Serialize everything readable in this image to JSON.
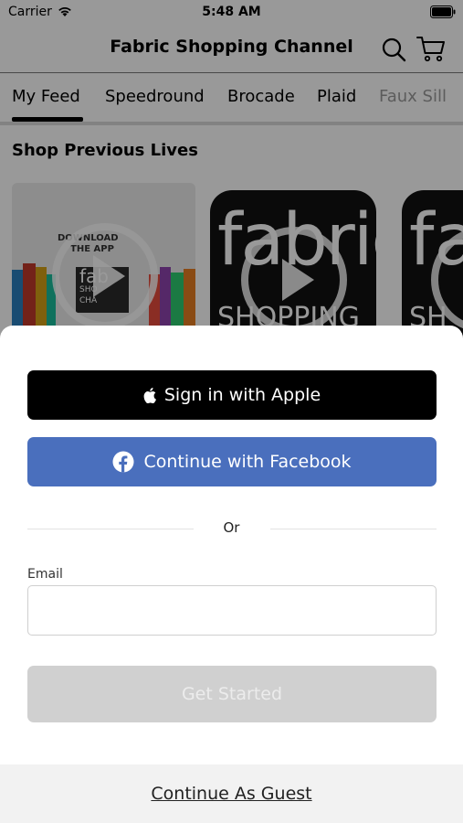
{
  "status_bar": {
    "carrier": "Carrier",
    "time": "5:48 AM"
  },
  "nav": {
    "title": "Fabric Shopping Channel",
    "icons": [
      "search-icon",
      "cart-icon"
    ]
  },
  "tabs": [
    {
      "label": "My Feed",
      "active": true
    },
    {
      "label": "Speedround",
      "active": false
    },
    {
      "label": "Brocade",
      "active": false
    },
    {
      "label": "Plaid",
      "active": false
    },
    {
      "label": "Faux Sill",
      "active": false
    }
  ],
  "section": {
    "title": "Shop Previous Lives"
  },
  "thumbnails": {
    "first": {
      "line1": "DOWNLOAD",
      "line2": "THE APP",
      "logo1": "fab",
      "logo2": "SHO",
      "logo3": "CHA"
    },
    "second": {
      "logo1": "fabric",
      "logo2": "SHOPPING"
    },
    "third": {
      "logo1": "fa",
      "logo2": "SH"
    }
  },
  "sheet": {
    "apple_button": "Sign in with Apple",
    "facebook_button": "Continue with Facebook",
    "divider_text": "Or",
    "email_label": "Email",
    "email_value": "",
    "get_started_button": "Get Started",
    "guest_link": "Continue As Guest"
  },
  "colors": {
    "facebook_blue": "#4a6fbd",
    "apple_black": "#000000",
    "disabled_gray": "#d0d0d0",
    "overlay": "rgba(0,0,0,0.40)"
  }
}
